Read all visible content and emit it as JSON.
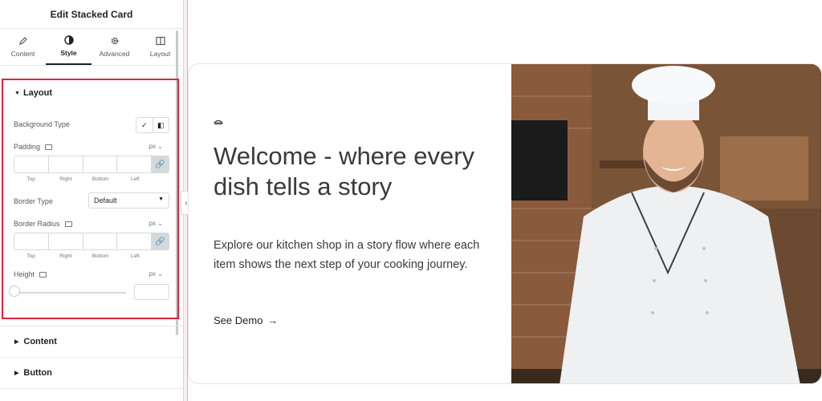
{
  "panel": {
    "title": "Edit Stacked Card",
    "tabs": [
      {
        "label": "Content",
        "icon": "pencil-icon"
      },
      {
        "label": "Style",
        "icon": "contrast-icon",
        "active": true
      },
      {
        "label": "Advanced",
        "icon": "gear-icon"
      },
      {
        "label": "Layout",
        "icon": "layout-icon"
      }
    ],
    "layout_section": {
      "title": "Layout",
      "background_type_label": "Background Type",
      "padding_label": "Padding",
      "padding_unit": "px",
      "border_type_label": "Border Type",
      "border_type_value": "Default",
      "border_radius_label": "Border Radius",
      "border_radius_unit": "px",
      "height_label": "Height",
      "height_unit": "px",
      "dim_labels": [
        "Top",
        "Right",
        "Bottom",
        "Left"
      ]
    },
    "collapsed_sections": [
      "Content",
      "Button"
    ]
  },
  "card": {
    "heading": "Welcome - where every dish tells a story",
    "description": "Explore our kitchen shop in a story flow where each item shows the next step of your cooking journey.",
    "link_label": "See Demo",
    "link_arrow": "→"
  },
  "colors": {
    "accent_outline": "#e0263a",
    "divider": "#f2c9dd"
  }
}
